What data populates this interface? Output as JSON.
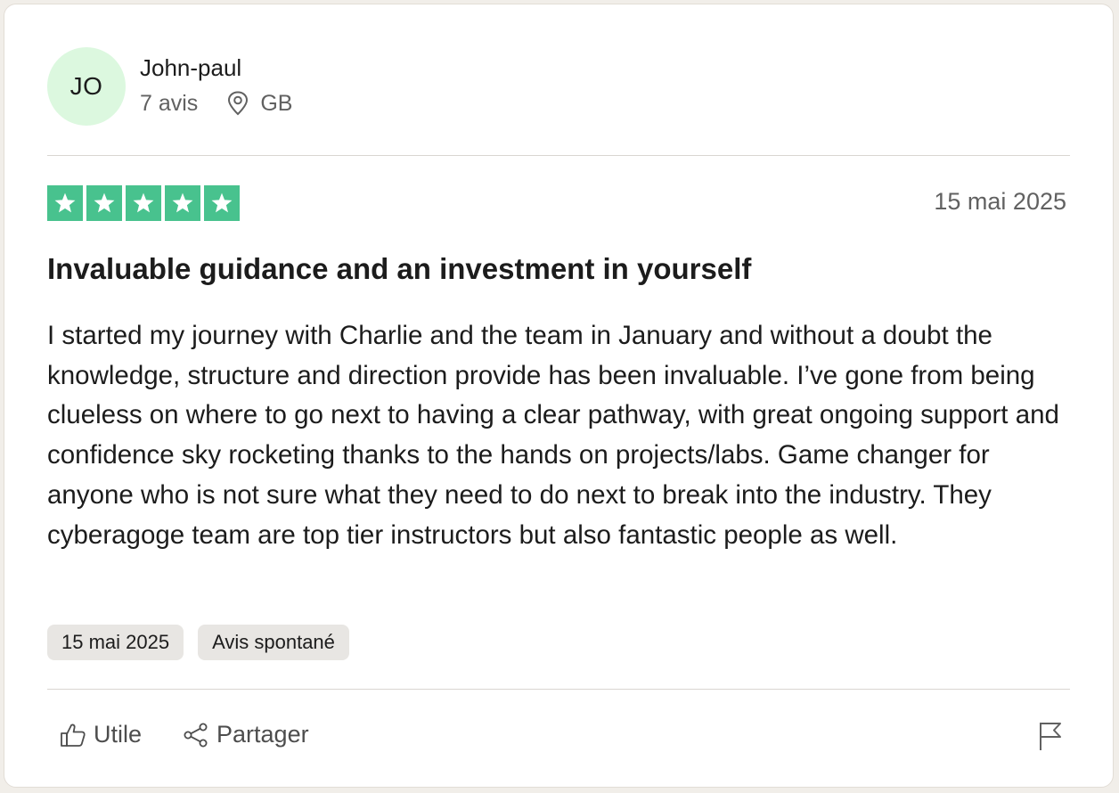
{
  "reviewer": {
    "initials": "JO",
    "name": "John-paul",
    "review_count": "7 avis",
    "location": "GB"
  },
  "review": {
    "rating": 5,
    "date": "15 mai 2025",
    "title": "Invaluable guidance and an investment in yourself",
    "body": "I started my journey with Charlie and the team in January and without a doubt the knowledge, structure and direction provide has been invaluable. I’ve gone from being clueless on where to go next to having a clear pathway, with great ongoing support and confidence sky rocketing thanks to the hands on projects/labs. Game changer for anyone who is not sure what they need to do next to break into the industry. They cyberagoge team are top tier instructors but also fantastic people as well."
  },
  "tags": [
    {
      "label": "15 mai 2025"
    },
    {
      "label": "Avis spontané"
    }
  ],
  "actions": {
    "useful_label": "Utile",
    "share_label": "Partager"
  },
  "colors": {
    "star_green": "#48c28e",
    "avatar_bg": "#dcf8df",
    "tag_bg": "#e8e6e3"
  },
  "icons": {
    "location": "map-pin-icon",
    "useful": "thumbs-up-icon",
    "share": "share-icon",
    "report": "flag-icon",
    "star": "star-icon"
  }
}
